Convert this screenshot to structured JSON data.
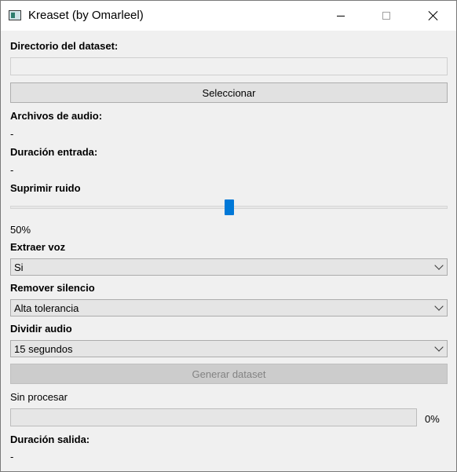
{
  "window": {
    "title": "Kreaset (by Omarleel)",
    "icons": [
      "app-icon",
      "minimize-icon",
      "maximize-icon",
      "close-icon"
    ]
  },
  "dataset": {
    "label": "Directorio del dataset:",
    "path_value": "",
    "select_button": "Seleccionar"
  },
  "audio_files": {
    "label": "Archivos de audio:",
    "value": "-"
  },
  "input_duration": {
    "label": "Duración entrada:",
    "value": "-"
  },
  "noise": {
    "label": "Suprimir ruido",
    "value_text": "50%",
    "level": 0.5
  },
  "extract_voice": {
    "label": "Extraer voz",
    "selected": "Si"
  },
  "remove_silence": {
    "label": "Remover silencio",
    "selected": "Alta tolerancia"
  },
  "split_audio": {
    "label": "Dividir audio",
    "selected": "15 segundos"
  },
  "generate_button": "Generar dataset",
  "status": "Sin procesar",
  "progress": {
    "value": 0,
    "text": "0%"
  },
  "output_duration": {
    "label": "Duración salida:",
    "value": "-"
  },
  "colors": {
    "accent": "#0078d7",
    "progress": "#06b025"
  }
}
